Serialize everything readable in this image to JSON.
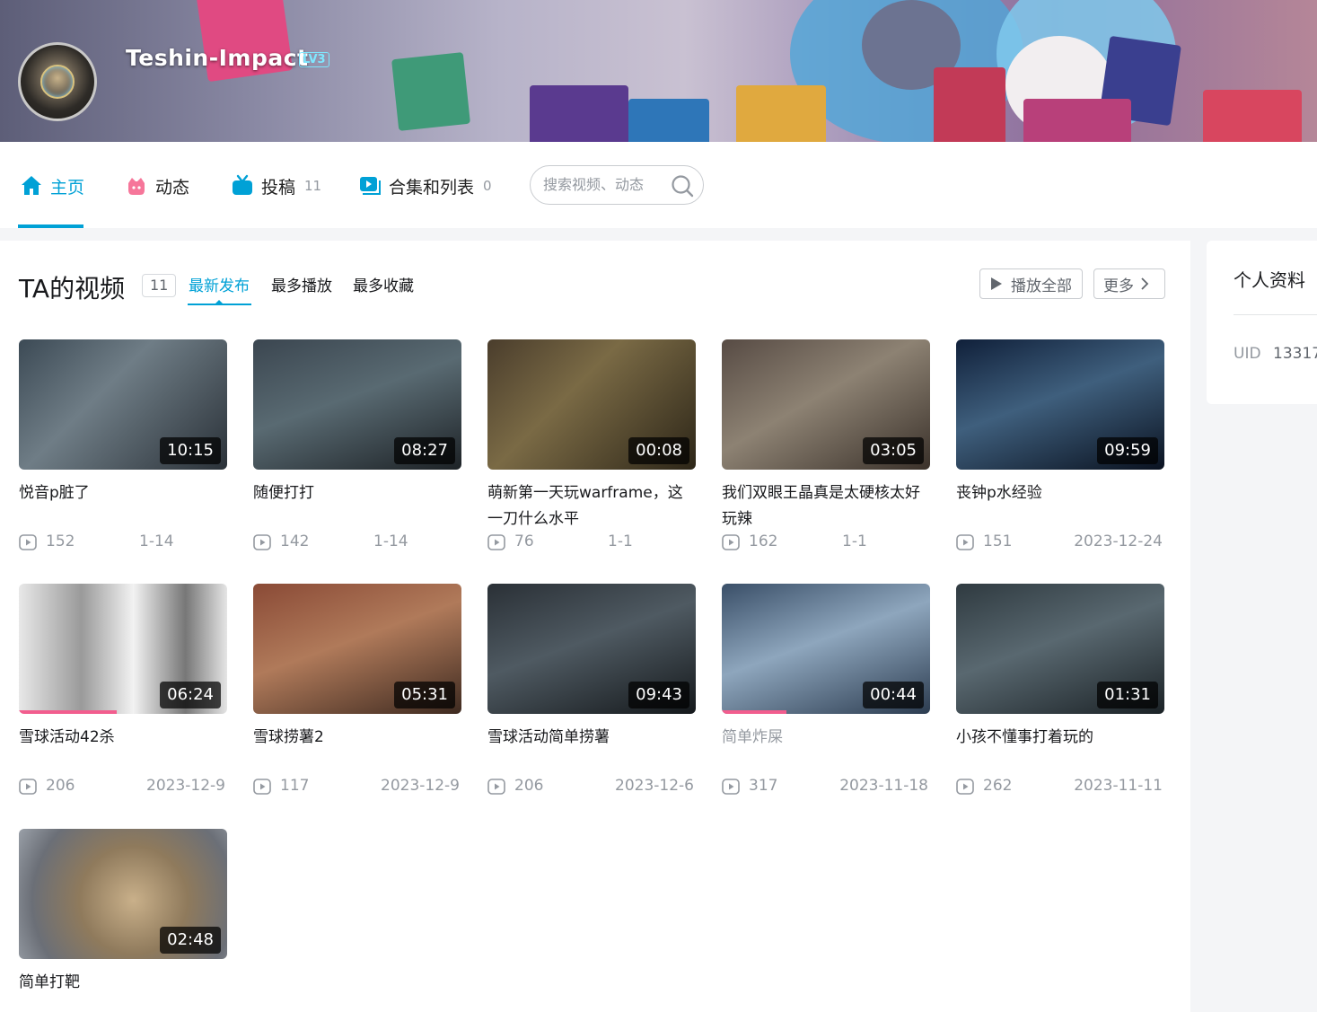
{
  "profile": {
    "username": "Teshin-Impact",
    "level": "LV3"
  },
  "nav": {
    "items": [
      {
        "label": "主页",
        "count": ""
      },
      {
        "label": "动态",
        "count": ""
      },
      {
        "label": "投稿",
        "count": "11"
      },
      {
        "label": "合集和列表",
        "count": "0"
      }
    ],
    "search_placeholder": "搜索视频、动态"
  },
  "videos_section": {
    "title": "TA的视频",
    "count": "11",
    "tabs": [
      "最新发布",
      "最多播放",
      "最多收藏"
    ],
    "play_all_label": "播放全部",
    "more_label": "更多"
  },
  "videos": [
    {
      "title": "悦音p脏了",
      "duration": "10:15",
      "views": "152",
      "date": "1-14"
    },
    {
      "title": "随便打打",
      "duration": "08:27",
      "views": "142",
      "date": "1-14"
    },
    {
      "title": "萌新第一天玩warframe，这一刀什么水平",
      "duration": "00:08",
      "views": "76",
      "date": "1-1"
    },
    {
      "title": "我们双眼王晶真是太硬核太好玩辣",
      "duration": "03:05",
      "views": "162",
      "date": "1-1"
    },
    {
      "title": "丧钟p水经验",
      "duration": "09:59",
      "views": "151",
      "date": "2023-12-24"
    },
    {
      "title": "雪球活动42杀",
      "duration": "06:24",
      "views": "206",
      "date": "2023-12-9"
    },
    {
      "title": "雪球捞薯2",
      "duration": "05:31",
      "views": "117",
      "date": "2023-12-9"
    },
    {
      "title": "雪球活动简单捞薯",
      "duration": "09:43",
      "views": "206",
      "date": "2023-12-6"
    },
    {
      "title": "简单炸屎",
      "duration": "00:44",
      "views": "317",
      "date": "2023-11-18"
    },
    {
      "title": "小孩不懂事打着玩的",
      "duration": "01:31",
      "views": "262",
      "date": "2023-11-11"
    },
    {
      "title": "简单打靶",
      "duration": "02:48",
      "views": "",
      "date": ""
    }
  ],
  "sidebar": {
    "title": "个人资料",
    "uid_label": "UID",
    "uid_value": "13317"
  },
  "colors": {
    "accent": "#00a1d6",
    "progress": "#f25d8e"
  }
}
